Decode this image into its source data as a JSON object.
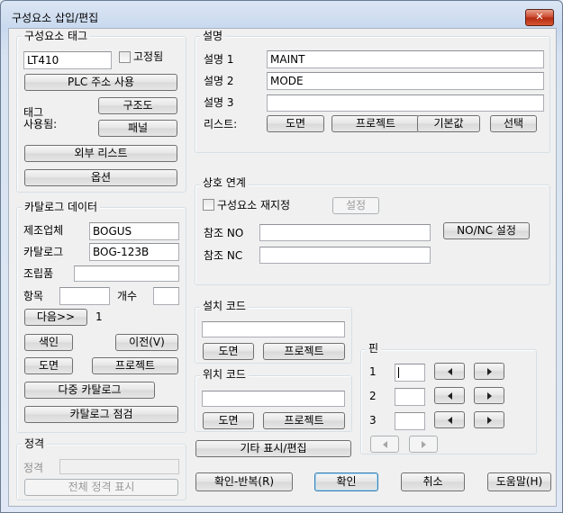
{
  "window": {
    "title": "구성요소 삽입/편집",
    "close_glyph": "✕"
  },
  "tag": {
    "group_label": "구성요소 태그",
    "value": "LT410",
    "fixed_label": "고정됨",
    "plc_button": "PLC 주소 사용",
    "used_label_line1": "태그",
    "used_label_line2": "사용됨:",
    "schematic_button": "구조도",
    "panel_button": "패널",
    "external_list_button": "외부 리스트",
    "options_button": "옵션"
  },
  "catalog": {
    "group_label": "카탈로그 데이터",
    "manufacturer_label": "제조업체",
    "manufacturer_value": "BOGUS",
    "catalog_label": "카탈로그",
    "catalog_value": "BOG-123B",
    "assembly_label": "조립품",
    "assembly_value": "",
    "item_label": "항목",
    "item_value": "",
    "count_label": "개수",
    "count_value": "",
    "next_button": "다음>>",
    "next_count": "1",
    "lookup_button": "색인",
    "previous_button": "이전(V)",
    "drawing_button": "도면",
    "project_button": "프로젝트",
    "multi_catalog_button": "다중 카탈로그",
    "catalog_check_button": "카탈로그 점검"
  },
  "rating": {
    "group_label": "정격",
    "rating_label": "정격",
    "rating_value": "",
    "show_all_button": "전체 정격 표시"
  },
  "description": {
    "group_label": "설명",
    "line1_label": "설명 1",
    "line1_value": "MAINT",
    "line2_label": "설명 2",
    "line2_value": "MODE",
    "line3_label": "설명 3",
    "line3_value": "",
    "list_label": "리스트:",
    "drawing_button": "도면",
    "project_button": "프로젝트",
    "defaults_button": "기본값",
    "pick_button": "선택"
  },
  "crossref": {
    "group_label": "상호 연계",
    "override_label": "구성요소 재지정",
    "setup_button": "설정",
    "ref_no_label": "참조 NO",
    "ref_no_value": "",
    "nonc_button": "NO/NC 설정",
    "ref_nc_label": "참조 NC",
    "ref_nc_value": ""
  },
  "install": {
    "group_label": "설치 코드",
    "value": "",
    "drawing_button": "도면",
    "project_button": "프로젝트"
  },
  "location": {
    "group_label": "위치 코드",
    "value": "",
    "drawing_button": "도면",
    "project_button": "프로젝트"
  },
  "pins": {
    "group_label": "핀",
    "rows": [
      {
        "label": "1",
        "value": ""
      },
      {
        "label": "2",
        "value": ""
      },
      {
        "label": "3",
        "value": ""
      }
    ]
  },
  "misc": {
    "other_display_button": "기타 표시/편집"
  },
  "footer": {
    "ok_repeat_button": "확인-반복(R)",
    "ok_button": "확인",
    "cancel_button": "취소",
    "help_button": "도움말(H)"
  }
}
